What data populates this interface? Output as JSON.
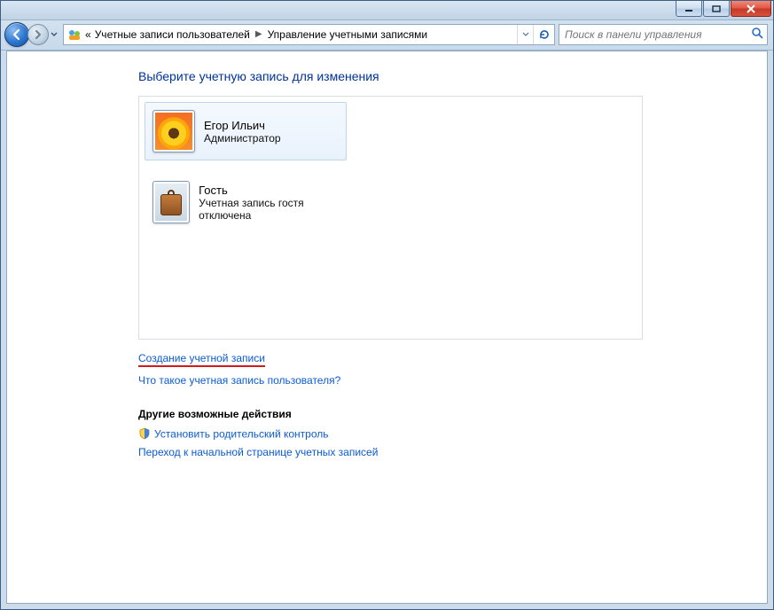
{
  "breadcrumb": {
    "prefix_glyph": "«",
    "part1": "Учетные записи пользователей",
    "part2": "Управление учетными записями"
  },
  "search": {
    "placeholder": "Поиск в панели управления"
  },
  "page": {
    "title": "Выберите учетную запись для изменения"
  },
  "accounts": [
    {
      "name": "Егор Ильич",
      "subtitle": "Администратор",
      "selected": true,
      "avatar": "sunflower"
    },
    {
      "name": "Гость",
      "subtitle": "Учетная запись гостя отключена",
      "selected": false,
      "avatar": "suitcase"
    }
  ],
  "links": {
    "create_account": "Создание учетной записи",
    "what_is_account": "Что такое учетная запись пользователя?"
  },
  "other_actions": {
    "header": "Другие возможные действия",
    "parental": "Установить родительский контроль",
    "go_home": "Переход к начальной странице учетных записей"
  }
}
